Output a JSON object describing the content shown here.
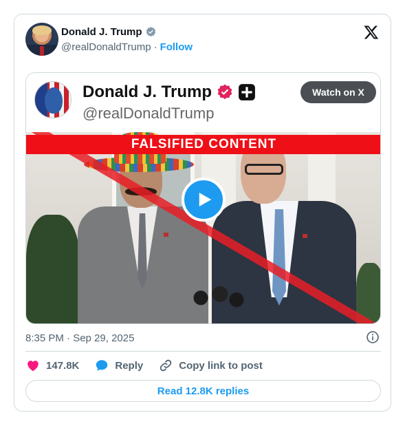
{
  "author": {
    "name": "Donald J. Trump",
    "handle": "@realDonaldTrump",
    "separator": "·",
    "follow_label": "Follow"
  },
  "embedded": {
    "name": "Donald J. Trump",
    "handle": "@realDonaldTrump",
    "watch_label": "Watch on X",
    "banner_text": "FALSIFIED CONTENT"
  },
  "meta": {
    "timestamp": "8:35 PM · Sep 29, 2025"
  },
  "actions": {
    "like_count": "147.8K",
    "reply_label": "Reply",
    "copy_label": "Copy link to post"
  },
  "replies_button": "Read 12.8K replies",
  "icons": {
    "verified": "verified-badge-icon",
    "x_logo": "x-logo-icon",
    "play": "play-icon",
    "info": "info-icon",
    "heart": "heart-icon",
    "reply": "reply-bubble-icon",
    "link": "link-icon"
  },
  "colors": {
    "accent": "#1d9bf0",
    "like": "#f91880",
    "banner": "#ef0f17",
    "muted": "#536471"
  }
}
